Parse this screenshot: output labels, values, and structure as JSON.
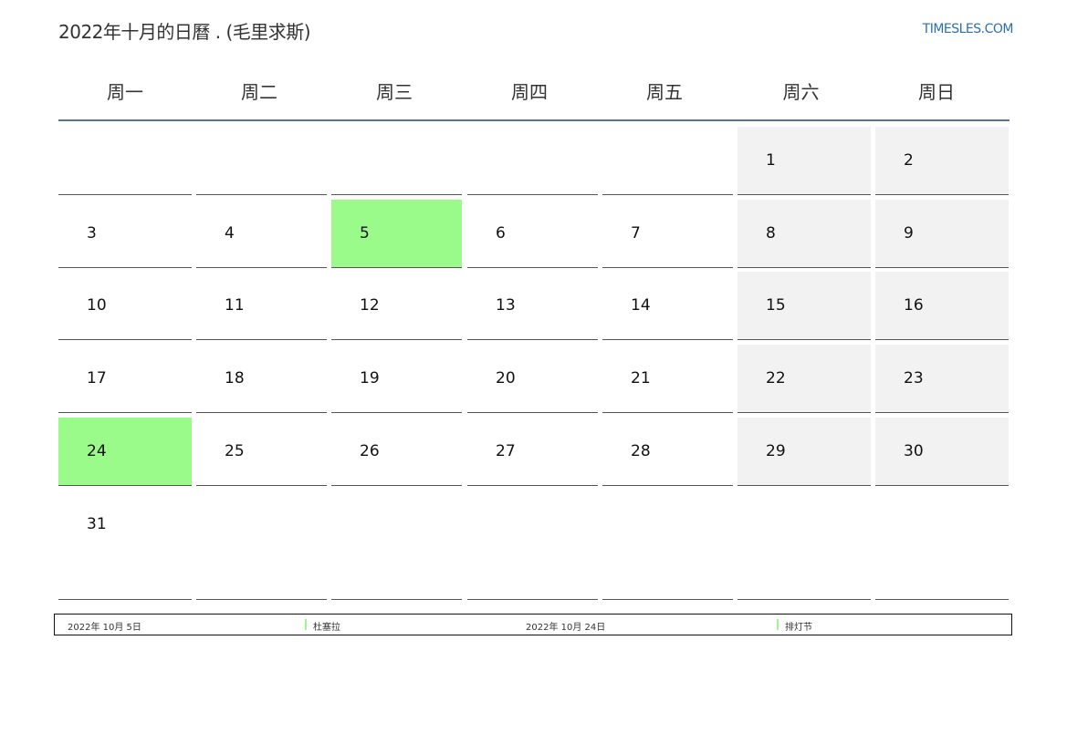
{
  "header": {
    "title": "2022年十月的日曆 . (毛里求斯)",
    "site": "TIMESLES.COM"
  },
  "weekdays": [
    "周一",
    "周二",
    "周三",
    "周四",
    "周五",
    "周六",
    "周日"
  ],
  "weeks": [
    [
      "",
      "",
      "",
      "",
      "",
      "1",
      "2"
    ],
    [
      "3",
      "4",
      "5",
      "6",
      "7",
      "8",
      "9"
    ],
    [
      "10",
      "11",
      "12",
      "13",
      "14",
      "15",
      "16"
    ],
    [
      "17",
      "18",
      "19",
      "20",
      "21",
      "22",
      "23"
    ],
    [
      "24",
      "25",
      "26",
      "27",
      "28",
      "29",
      "30"
    ],
    [
      "31",
      "",
      "",
      "",
      "",
      "",
      ""
    ]
  ],
  "holidays": [
    {
      "date": "2022年 10月 5日",
      "name": "杜塞拉",
      "day": "5"
    },
    {
      "date": "2022年 10月 24日",
      "name": "排灯节",
      "day": "24"
    }
  ],
  "colors": {
    "holiday": "#9bfb8a",
    "weekend": "#f2f2f2",
    "header_rule": "#5a7393",
    "link": "#2a6fb0"
  }
}
